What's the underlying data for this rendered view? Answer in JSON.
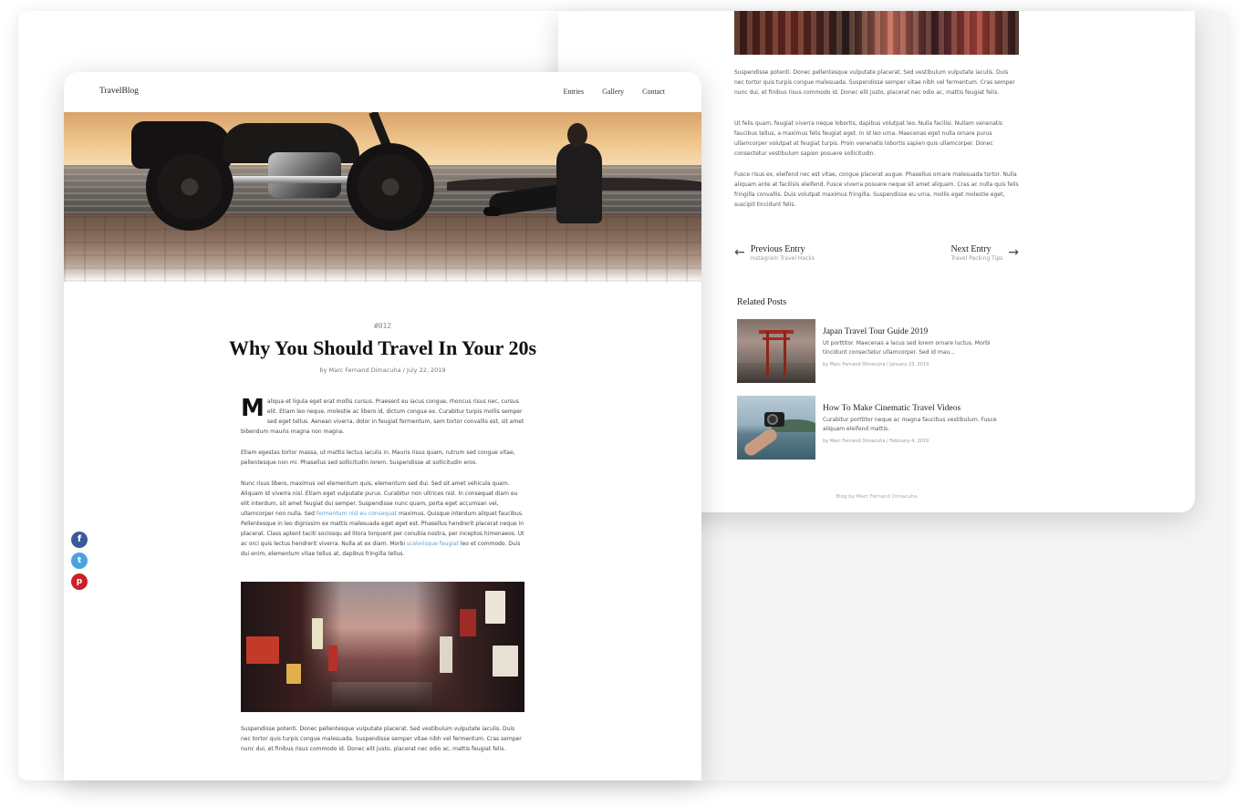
{
  "front": {
    "logo": "TravelBlog",
    "nav": [
      "Entries",
      "Gallery",
      "Contact"
    ],
    "issue_number": "#012",
    "post_title": "Why You Should Travel In Your 20s",
    "byline": "by Marc Fernand Dimacuha / July 22, 2019",
    "para1_dropcap": "M",
    "para1": "aliqua et ligula eget erat mollis cursus. Praesent eu iacus congue, rhoncus risus nec, cursus elit. Etiam leo neque, molestie ac libero id, dictum congue ex. Curabitur turpis mollis semper sed eget tellus. Aenean viverra, dolor in feugiat fermentum, sem tortor convallis est, sit amet bibendum mauris magna non magna.",
    "para2": "Etiam egestas tortor massa, ut mattis lectus iaculis in. Mauris risus quam, rutrum sed congue vitae, pellentesque non mi. Phasellus sed sollicitudin lorem. Suspendisse at sollicitudin eros.",
    "para3_a": "Nunc risus libero, maximus vel elementum quis, elementum sed dui. Sed sit amet vehicula quam. Aliquam id viverra nisl. Etiam eget vulputate purus. Curabitur non ultrices nisl. In consequat diam eu elit interdum, sit amet feugiat dui semper. Suspendisse nunc quam, porta eget accumsan vel, ullamcorper non nulla. Sed ",
    "para3_link1": "fermentum nisl eu consequat",
    "para3_b": " maximus. Quisque interdum aliquet faucibus. Pellentesque in leo dignissim ex mattis malesuada eget eget est. Phasellus hendrerit placerat neque in placerat. Class aptent taciti sociosqu ad litora torquent per conubia nostra, per inceptos himenaeos. Ut ac orci quis lectus hendrerit viverra. Nulla at ex diam. Morbi ",
    "para3_link2": "scelerisque feugiat",
    "para3_c": " leo et commodo. Duis dui enim, elementum vitae tellus at, dapibus fringilla tellus.",
    "para4": "Suspendisse potenti. Donec pellentesque vulputate placerat. Sed vestibulum vulputate iaculis. Duis nec tortor quis turpis congue malesuada. Suspendisse semper vitae nibh vel fermentum. Cras semper nunc dui, et finibus risus commodo id. Donec elit justo, placerat nec odio ac, mattis feugiat felis.",
    "social": {
      "facebook": "f",
      "twitter": "t",
      "pinterest": "p"
    }
  },
  "back": {
    "para1": "Suspendisse potenti. Donec pellentesque vulputate placerat. Sed vestibulum vulputate iaculis. Duis nec tortor quis turpis congue malesuada. Suspendisse semper vitae nibh vel fermentum. Cras semper nunc dui, et finibus risus commodo id. Donec elit justo, placerat nec odio ac, mattis feugiat felis.",
    "para2": "Ut felis quam, feugiat viverra neque lobortis, dapibus volutpat leo. Nulla facilisi. Nullam venenatis faucibus tellus, a maximus felis feugiat eget. In id leo urna. Maecenas eget nulla ornare purus ullamcorper volutpat at feugiat turpis. Proin venenatis lobortis sapien quis ullamcorper. Donec consectetur vestibulum sapien posuere sollicitudin.",
    "para3": "Fusce risus ex, eleifend nec est vitae, congue placerat augue. Phasellus ornare malesuada tortor. Nulla aliquam ante at facilisis eleifend. Fusce viverra posuere neque sit amet aliquam. Cras ac nulla quis felis fringilla convallis. Duis volutpat maximus fringilla. Suspendisse eu urna, mollis eget molestie eget, suscipit tincidunt felis.",
    "prev_label": "Previous Entry",
    "prev_sub": "Instagram Travel Hacks",
    "next_label": "Next Entry",
    "next_sub": "Travel Packing Tips",
    "related_heading": "Related Posts",
    "related": [
      {
        "title": "Japan Travel Tour Guide 2019",
        "desc": "Ut porttitor. Maecenas a lacus sed lorem ornare luctus. Morbi tincidunt consectetur ullamcorper. Sed id mau...",
        "meta": "by Marc Fernand Dimacuha / January 23, 2019"
      },
      {
        "title": "How To Make Cinematic Travel Videos",
        "desc": "Curabitur porttitor neque ac magna faucibus vestibulum. Fusce aliquam eleifend mattis.",
        "meta": "by Marc Fernand Dimacuha / February 4, 2019"
      }
    ],
    "footer": "Blog by Marc Fernand Dimacuha"
  },
  "colors": {
    "link": "#5a9fd8",
    "facebook": "#3b5998",
    "twitter": "#4aa3df",
    "pinterest": "#cb2027"
  }
}
